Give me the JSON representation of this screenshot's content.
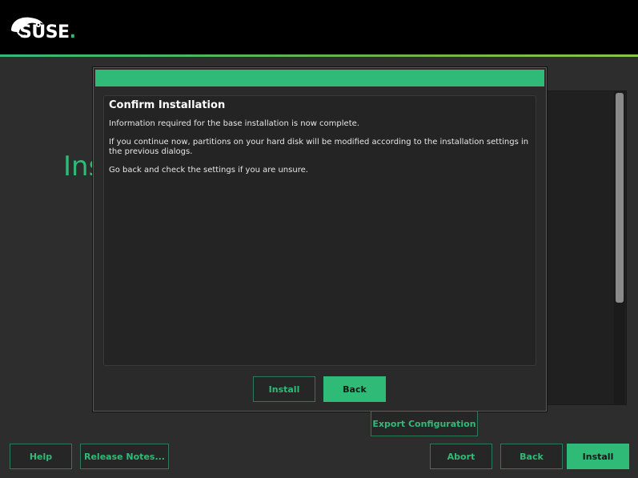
{
  "brand": {
    "logo_text": "SUSE",
    "accent_color": "#30ba78"
  },
  "background": {
    "title_visible": "Ins"
  },
  "dialog": {
    "heading": "Confirm Installation",
    "paragraphs": [
      "Information required for the base installation is now complete.",
      "If you continue now, partitions on your hard disk will be modified according to the installation settings in the previous dialogs.",
      "Go back and check the settings if you are unsure."
    ],
    "install_label": "Install",
    "back_label": "Back"
  },
  "buttons": {
    "export": "Export Configuration",
    "help": "Help",
    "release_notes": "Release Notes...",
    "abort": "Abort",
    "back": "Back",
    "install": "Install"
  },
  "icons": {
    "logo": "suse-chameleon-icon"
  }
}
